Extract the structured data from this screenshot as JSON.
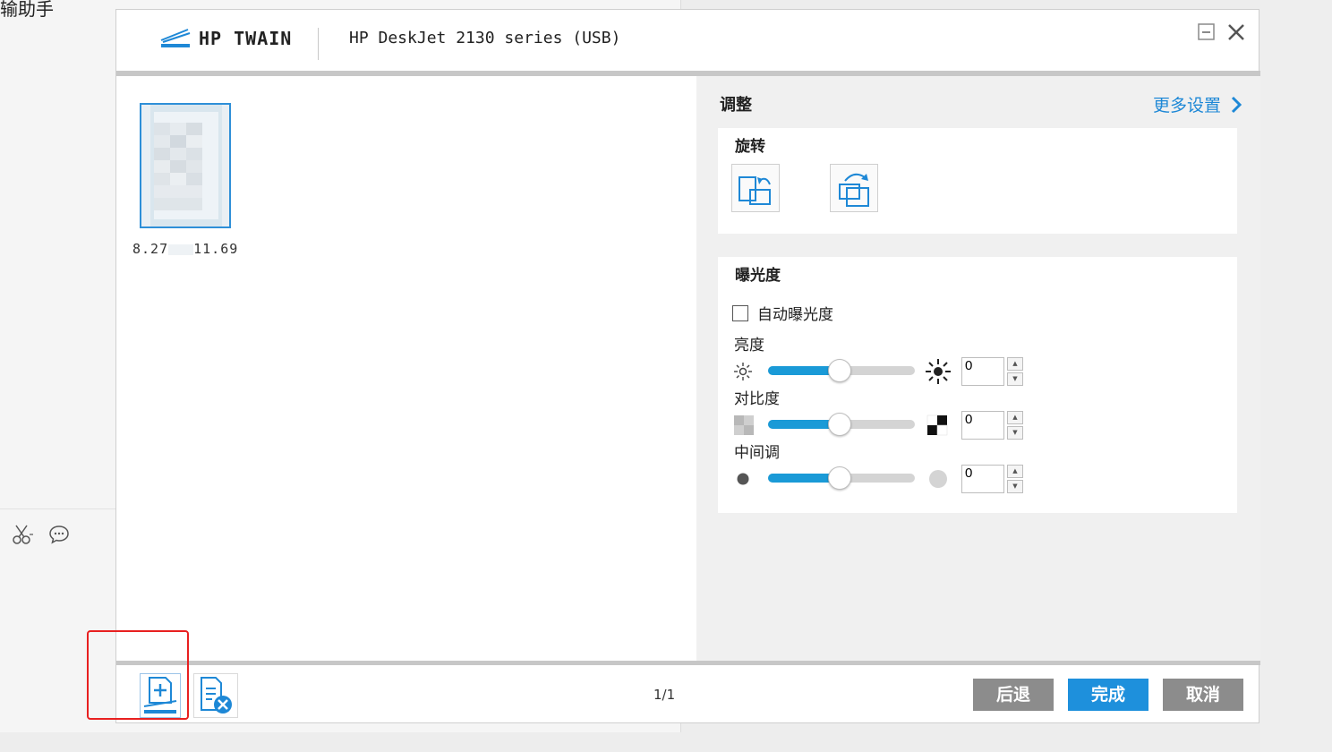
{
  "background_app": {
    "title": "输助手"
  },
  "dialog": {
    "brand": "HP TWAIN",
    "device": "HP DeskJet 2130 series (USB)",
    "brand_color": "#1e88d6"
  },
  "preview": {
    "thumb_width": "8.27",
    "thumb_height": "11.69"
  },
  "panel": {
    "adjust_label": "调整",
    "more_settings_label": "更多设置",
    "rotation": {
      "label": "旋转"
    },
    "exposure": {
      "label": "曝光度",
      "auto_label": "自动曝光度",
      "auto_checked": false,
      "brightness": {
        "label": "亮度",
        "value": "0"
      },
      "contrast": {
        "label": "对比度",
        "value": "0"
      },
      "midtone": {
        "label": "中间调",
        "value": "0"
      }
    }
  },
  "footer": {
    "page_count": "1/1",
    "back_label": "后退",
    "done_label": "完成",
    "cancel_label": "取消"
  }
}
